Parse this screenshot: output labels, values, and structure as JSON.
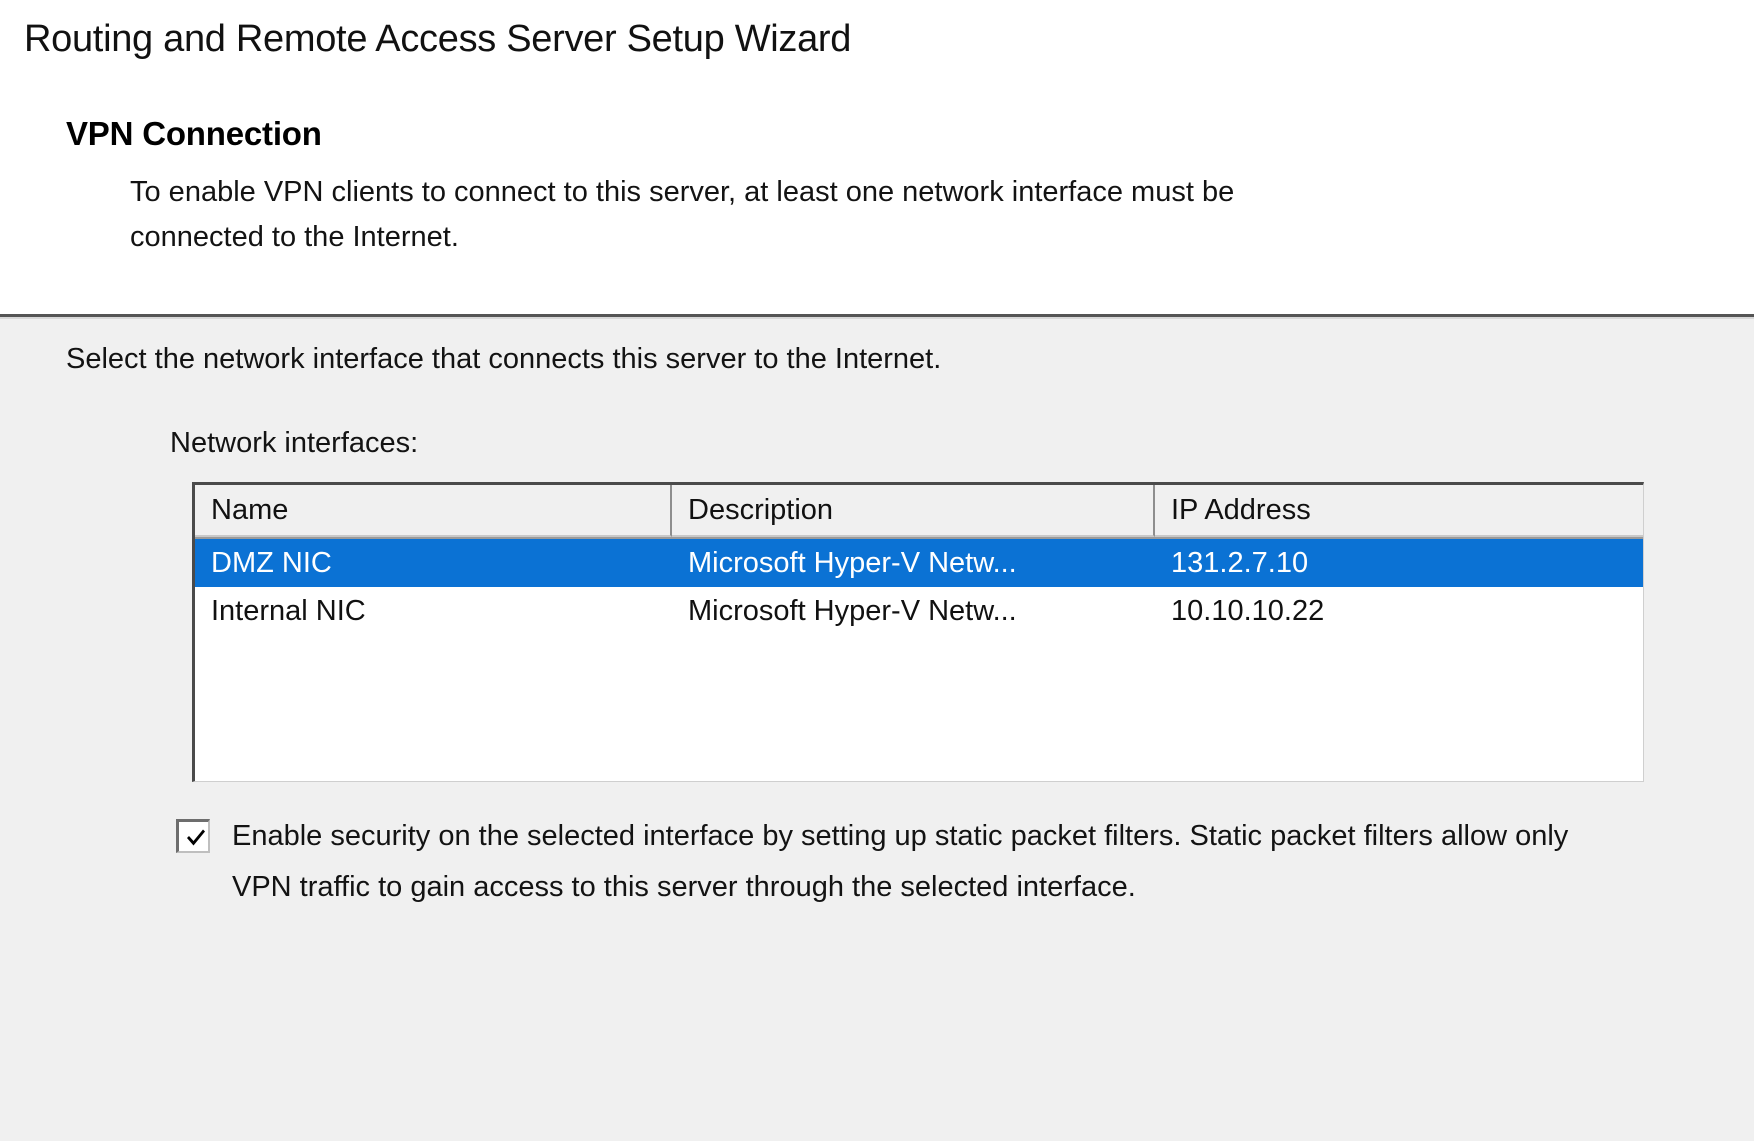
{
  "window": {
    "title": "Routing and Remote Access Server Setup Wizard"
  },
  "header": {
    "heading": "VPN Connection",
    "subtext": "To enable VPN clients to connect to this server, at least one network interface must be connected to the Internet."
  },
  "body": {
    "instruction": "Select the network interface that connects this server to the Internet.",
    "list_label": "Network interfaces:"
  },
  "listview": {
    "columns": [
      {
        "label": "Name"
      },
      {
        "label": "Description"
      },
      {
        "label": "IP Address"
      }
    ],
    "rows": [
      {
        "name": "DMZ NIC",
        "description": "Microsoft Hyper-V Netw...",
        "ip": "131.2.7.10",
        "selected": true
      },
      {
        "name": "Internal NIC",
        "description": "Microsoft Hyper-V Netw...",
        "ip": "10.10.10.22",
        "selected": false
      }
    ]
  },
  "checkbox": {
    "checked": true,
    "label": "Enable security on the selected interface by setting up static packet filters. Static packet filters allow only VPN traffic to gain access to this server through the selected interface."
  },
  "colors": {
    "selection_blue": "#0b72d4",
    "body_background": "#f0f0f0",
    "header_background": "#ffffff",
    "text": "#131313"
  }
}
